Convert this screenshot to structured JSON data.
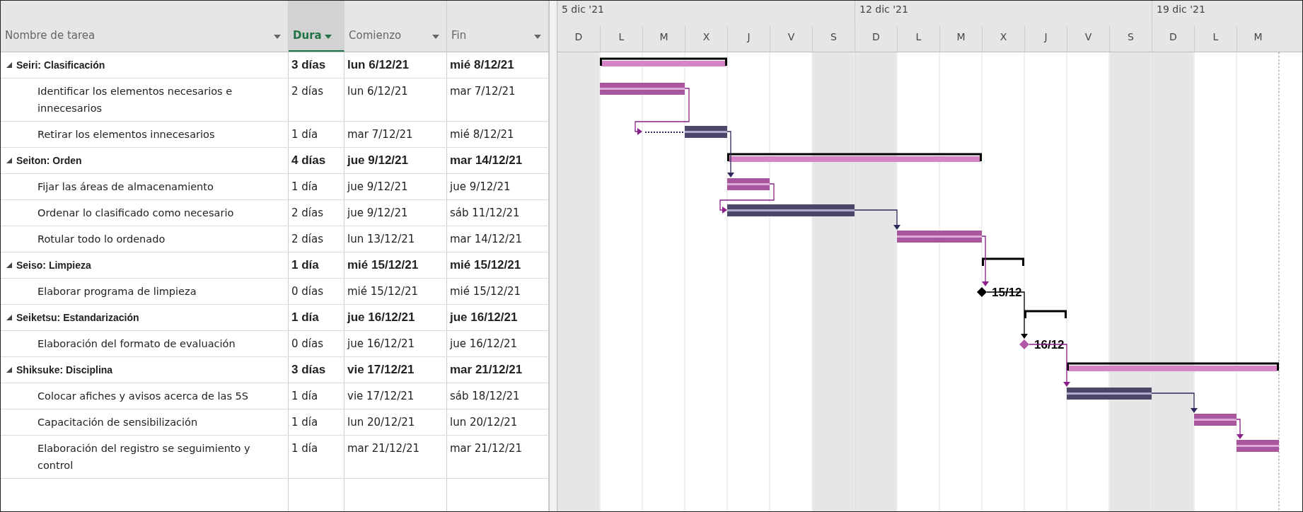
{
  "columns": [
    {
      "label": "Nombre de tarea",
      "selected": false
    },
    {
      "label": "Dura",
      "selected": true
    },
    {
      "label": "Comienzo",
      "selected": false
    },
    {
      "label": "Fin",
      "selected": false
    }
  ],
  "timescale": {
    "weeks": [
      "5 dic '21",
      "12 dic '21",
      "19 dic '21"
    ],
    "days": [
      {
        "label": "D",
        "weekend": true
      },
      {
        "label": "L",
        "weekend": false
      },
      {
        "label": "M",
        "weekend": false
      },
      {
        "label": "X",
        "weekend": false
      },
      {
        "label": "J",
        "weekend": false
      },
      {
        "label": "V",
        "weekend": false
      },
      {
        "label": "S",
        "weekend": true
      },
      {
        "label": "D",
        "weekend": true
      },
      {
        "label": "L",
        "weekend": false
      },
      {
        "label": "M",
        "weekend": false
      },
      {
        "label": "X",
        "weekend": false
      },
      {
        "label": "J",
        "weekend": false
      },
      {
        "label": "V",
        "weekend": false
      },
      {
        "label": "S",
        "weekend": true
      },
      {
        "label": "D",
        "weekend": true
      },
      {
        "label": "L",
        "weekend": false
      },
      {
        "label": "M",
        "weekend": false
      }
    ]
  },
  "phases": [
    {
      "name": "Seiri: Clasificación",
      "expanded": true,
      "duration": "3 días",
      "start": "lun 6/12/21",
      "finish": "mié 8/12/21",
      "children": [
        {
          "name": "Identificar los elementos necesarios e innecesarios",
          "duration": "2 días",
          "start": "lun 6/12/21",
          "finish": "mar 7/12/21",
          "kind": "task",
          "critical": true
        },
        {
          "name": "Retirar los elementos innecesarios",
          "duration": "1 día",
          "start": "mar 7/12/21",
          "finish": "mié 8/12/21",
          "kind": "split",
          "critical": false
        }
      ]
    },
    {
      "name": "Seiton: Orden",
      "expanded": true,
      "duration": "4 días",
      "start": "jue 9/12/21",
      "finish": "mar 14/12/21",
      "children": [
        {
          "name": "Fijar las áreas de almacenamiento",
          "duration": "1 día",
          "start": "jue 9/12/21",
          "finish": "jue 9/12/21",
          "kind": "task",
          "critical": true
        },
        {
          "name": "Ordenar lo clasificado como necesario",
          "duration": "2 días",
          "start": "jue 9/12/21",
          "finish": "sáb 11/12/21",
          "kind": "task",
          "critical": false
        },
        {
          "name": "Rotular todo lo ordenado",
          "duration": "2 días",
          "start": "lun 13/12/21",
          "finish": "mar 14/12/21",
          "kind": "task",
          "critical": true
        }
      ]
    },
    {
      "name": "Seiso: Limpieza",
      "expanded": true,
      "duration": "1 día",
      "start": "mié 15/12/21",
      "finish": "mié 15/12/21",
      "children": [
        {
          "name": "Elaborar programa de limpieza",
          "duration": "0 días",
          "start": "mié 15/12/21",
          "finish": "mié 15/12/21",
          "kind": "milestone",
          "critical": false,
          "label": "15/12"
        }
      ]
    },
    {
      "name": "Seiketsu: Estandarización",
      "expanded": true,
      "duration": "1 día",
      "start": "jue 16/12/21",
      "finish": "jue 16/12/21",
      "children": [
        {
          "name": "Elaboración del formato de evaluación",
          "duration": "0 días",
          "start": "jue 16/12/21",
          "finish": "jue 16/12/21",
          "kind": "milestone",
          "critical": true,
          "label": "16/12"
        }
      ]
    },
    {
      "name": "Shiksuke: Disciplina",
      "expanded": true,
      "duration": "3 días",
      "start": "vie 17/12/21",
      "finish": "mar 21/12/21",
      "children": [
        {
          "name": "Colocar afiches y avisos acerca de las 5S",
          "duration": "1 día",
          "start": "vie 17/12/21",
          "finish": "sáb 18/12/21",
          "kind": "task",
          "critical": false
        },
        {
          "name": "Capacitación de sensibilización",
          "duration": "1 día",
          "start": "lun 20/12/21",
          "finish": "lun 20/12/21",
          "kind": "task",
          "critical": true
        },
        {
          "name": "Elaboración del registro se seguimiento y control",
          "duration": "1 día",
          "start": "mar 21/12/21",
          "finish": "mar 21/12/21",
          "kind": "task",
          "critical": true
        }
      ]
    }
  ]
}
